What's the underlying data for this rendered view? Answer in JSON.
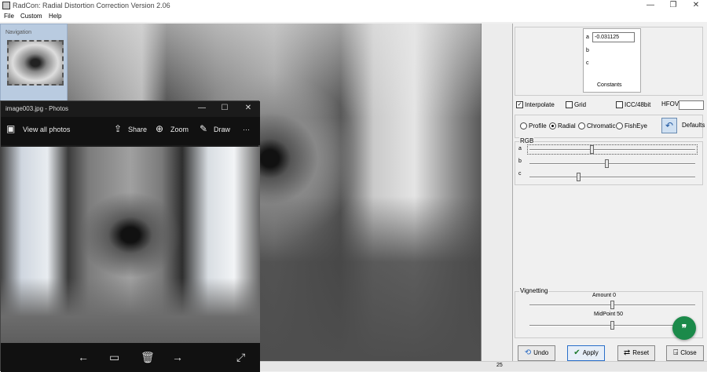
{
  "window": {
    "title": "RadCon: Radial Distortion Correction Version 2.06",
    "minimize": "—",
    "maximize": "❐",
    "close": "✕"
  },
  "menu": [
    "File",
    "Custom",
    "Help"
  ],
  "navigation": {
    "label": "Navigation"
  },
  "photos": {
    "title": "image003.jpg - Photos",
    "minimize": "—",
    "maximize": "☐",
    "close": "✕",
    "view_all": "View all photos",
    "share": "Share",
    "zoom": "Zoom",
    "draw": "Draw",
    "more": "···"
  },
  "constants": {
    "a_label": "a",
    "a_value": "-0.031125",
    "b_label": "b",
    "c_label": "c",
    "title": "Constants"
  },
  "options": {
    "interpolate": "Interpolate",
    "grid": "Grid",
    "icc": "ICC/48bit",
    "hfov": "HFOV"
  },
  "modes": {
    "profile": "Profile",
    "radial": "Radial",
    "chromatic": "Chromatic",
    "fisheye": "FishEye",
    "defaults": "Defaults",
    "selected": "radial"
  },
  "rgb": {
    "title": "RGB",
    "a_label": "a",
    "b_label": "b",
    "c_label": "c",
    "a_level": 0.38,
    "b_level": 0.47,
    "c_level": 0.3
  },
  "vignetting": {
    "title": "Vignetting",
    "amount_label": "Amount 0",
    "midpoint_label": "MidPoint 50",
    "amount_level": 0.5,
    "midpoint_level": 0.5
  },
  "buttons": {
    "undo": "Undo",
    "apply": "Apply",
    "reset": "Reset",
    "close": "Close"
  },
  "status": {
    "value": "25"
  }
}
